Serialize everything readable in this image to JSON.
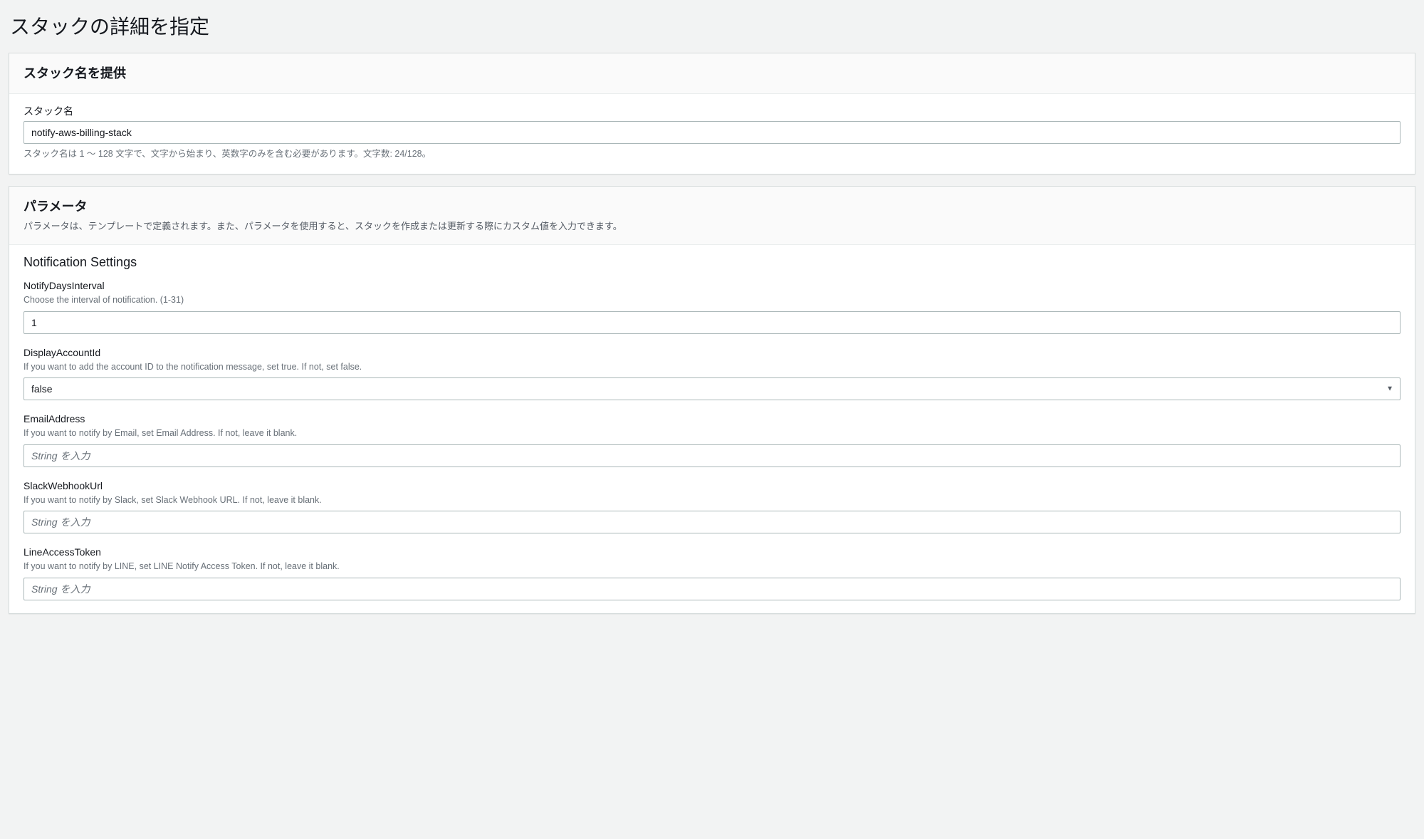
{
  "page": {
    "title": "スタックの詳細を指定"
  },
  "stackNamePanel": {
    "header": "スタック名を提供",
    "label": "スタック名",
    "value": "notify-aws-billing-stack",
    "help": "スタック名は 1 ～ 128 文字で、文字から始まり、英数字のみを含む必要があります。文字数: 24/128。"
  },
  "parametersPanel": {
    "header": "パラメータ",
    "desc": "パラメータは、テンプレートで定義されます。また、パラメータを使用すると、スタックを作成または更新する際にカスタム値を入力できます。",
    "sectionTitle": "Notification Settings",
    "fields": {
      "notifyDaysInterval": {
        "label": "NotifyDaysInterval",
        "desc": "Choose the interval of notification. (1-31)",
        "value": "1"
      },
      "displayAccountId": {
        "label": "DisplayAccountId",
        "desc": "If you want to add the account ID to the notification message, set true. If not, set false.",
        "value": "false"
      },
      "emailAddress": {
        "label": "EmailAddress",
        "desc": "If you want to notify by Email, set Email Address. If not, leave it blank.",
        "placeholder": "String を入力",
        "value": ""
      },
      "slackWebhookUrl": {
        "label": "SlackWebhookUrl",
        "desc": "If you want to notify by Slack, set Slack Webhook URL. If not, leave it blank.",
        "placeholder": "String を入力",
        "value": ""
      },
      "lineAccessToken": {
        "label": "LineAccessToken",
        "desc": "If you want to notify by LINE, set LINE Notify Access Token. If not, leave it blank.",
        "placeholder": "String を入力",
        "value": ""
      }
    }
  }
}
